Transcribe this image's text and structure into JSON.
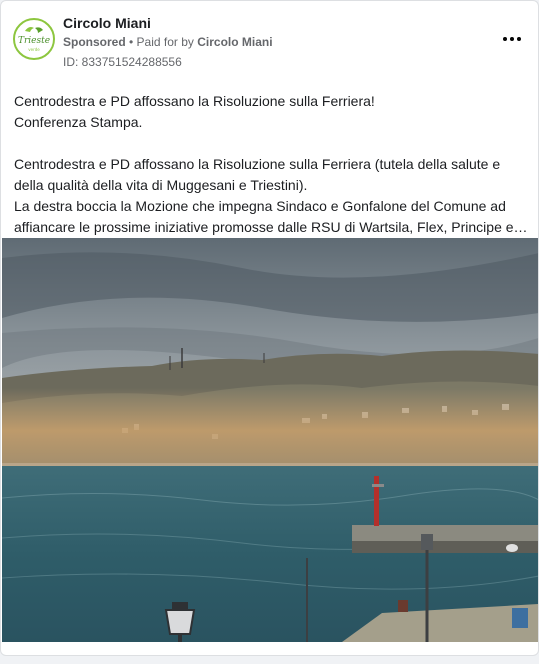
{
  "post": {
    "page_name": "Circolo Miani",
    "sponsored_label": "Sponsored",
    "separator": " • ",
    "paid_for_prefix": "Paid for by ",
    "paid_for_name": "Circolo Miani",
    "ad_id": "ID: 833751524288556",
    "more_icon": "more-horizontal-icon",
    "avatar_text": "Trieste",
    "avatar_subtext": "verde",
    "body_lines": [
      "Centrodestra e PD affossano la Risoluzione sulla Ferriera!",
      "Conferenza Stampa.",
      "",
      "Centrodestra e PD affossano la Risoluzione sulla Ferriera (tutela della salute e",
      "della qualità della vita di Muggesani e Triestini).",
      "La destra boccia la Mozione che impegna Sindaco e Gonfalone del Comune ad",
      "affiancare le prossime iniziative promosse dalle RSU di Wartsila, Flex, Principe e…"
    ]
  },
  "colors": {
    "avatar_ring": "#8dc63f",
    "text_primary": "#1c1e21",
    "text_secondary": "#65676b"
  }
}
